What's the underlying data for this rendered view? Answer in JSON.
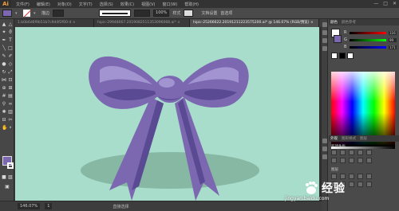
{
  "app": {
    "logo": "Ai",
    "window_buttons": [
      "—",
      "□",
      "✕"
    ]
  },
  "menu": [
    "文件(F)",
    "编辑(E)",
    "对象(O)",
    "文字(T)",
    "选择(S)",
    "效果(C)",
    "视图(V)",
    "窗口(W)",
    "帮助(H)"
  ],
  "control_bar": {
    "stroke_weight_label": "描边",
    "opacity_value": "100%",
    "style_label": "样式",
    "doc_setup": "文档设置",
    "prefs": "首选项"
  },
  "tabs": [
    {
      "label": "1.b0b6d6f9b51b7c9d4f2f00-d  ×",
      "active": false
    },
    {
      "label": "hipic-29948067.2019082511353096068.ai* ×",
      "active": false
    },
    {
      "label": "hipic-25266622.20191211223575200.ai* @ 146.07% (RGB/预览)  ×",
      "active": true
    }
  ],
  "status_bar": {
    "zoom": "146.07%",
    "page": "1",
    "tool": "直接选择"
  },
  "panels": {
    "color_tabs": [
      "颜色",
      "颜色参考"
    ],
    "sliders": [
      {
        "label": "R",
        "value": "116"
      },
      {
        "label": "G",
        "value": "99"
      },
      {
        "label": "B",
        "value": "171"
      }
    ],
    "lower_tabs": [
      "外观",
      "图形样式",
      "图层"
    ],
    "swatch_label": "新建色板",
    "layers_label": "图层"
  },
  "colors": {
    "bow_main": "#7b68b0",
    "bow_dark": "#5a4a94",
    "bow_light": "#a294d0",
    "shadow": "#86b8a4",
    "canvas_bg": "#a8dccb"
  },
  "watermark": {
    "text": "经验",
    "sub": "jingyan.baidu.com"
  }
}
